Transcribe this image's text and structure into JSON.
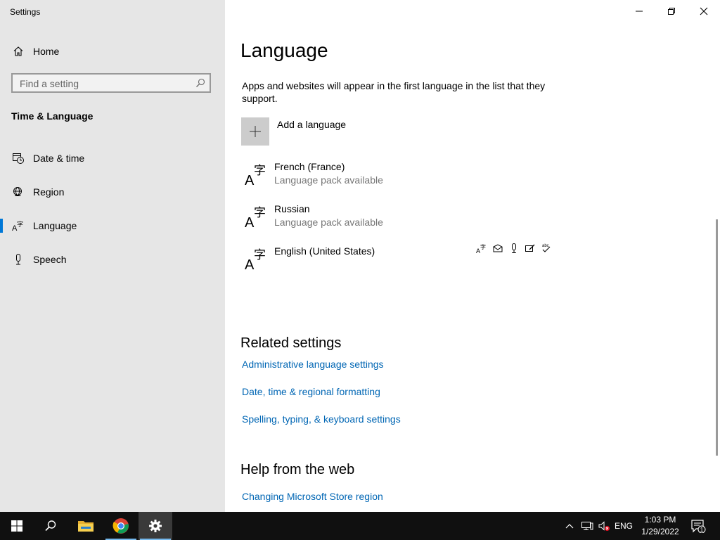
{
  "window": {
    "title": "Settings"
  },
  "sidebar": {
    "home_label": "Home",
    "search_placeholder": "Find a setting",
    "section_title": "Time & Language",
    "items": [
      {
        "label": "Date & time",
        "icon": "calendar-clock-icon"
      },
      {
        "label": "Region",
        "icon": "globe-icon"
      },
      {
        "label": "Language",
        "icon": "language-icon",
        "active": true
      },
      {
        "label": "Speech",
        "icon": "microphone-icon"
      }
    ]
  },
  "main": {
    "title": "Language",
    "description": "Apps and websites will appear in the first language in the list that they support.",
    "add_language_label": "Add a language",
    "languages": [
      {
        "name": "French (France)",
        "status": "Language pack available"
      },
      {
        "name": "Russian",
        "status": "Language pack available"
      },
      {
        "name": "English (United States)",
        "status": ""
      }
    ],
    "related_title": "Related settings",
    "related_links": [
      "Administrative language settings",
      "Date, time & regional formatting",
      "Spelling, typing, & keyboard settings"
    ],
    "help_title": "Help from the web",
    "help_links": [
      "Changing Microsoft Store region"
    ]
  },
  "taskbar": {
    "input_indicator": "ENG",
    "time": "1:03 PM",
    "date": "1/29/2022",
    "notification_count": "1"
  },
  "colors": {
    "accent": "#0078d7",
    "link": "#0066b4",
    "sidebar_bg": "#e6e6e6",
    "taskbar_bg": "#101010"
  }
}
